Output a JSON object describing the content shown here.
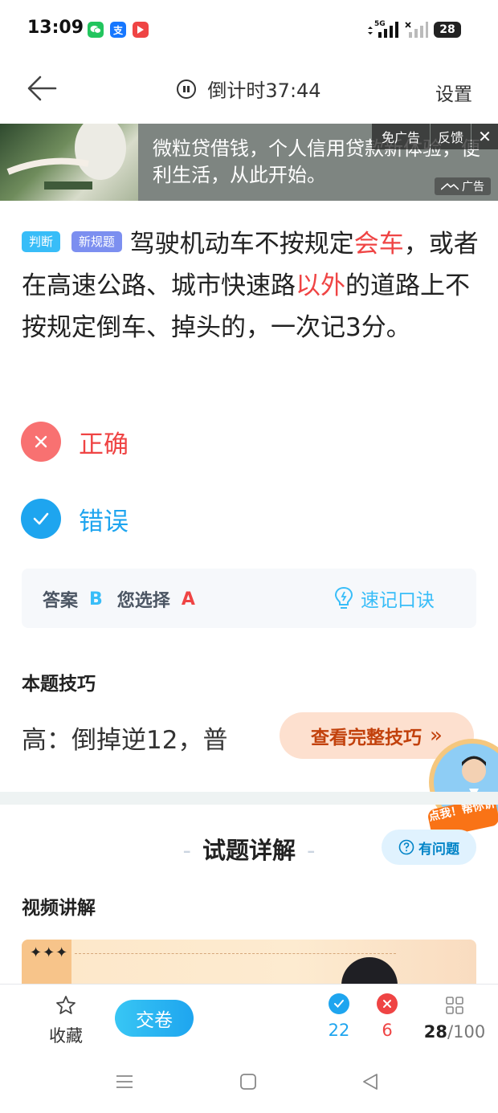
{
  "status_bar": {
    "time": "13:09",
    "apps": [
      {
        "icon": "wechat-icon",
        "color": "#22c55e",
        "glyph": "◉"
      },
      {
        "icon": "alipay-icon",
        "color": "#1677ff",
        "glyph": "支"
      },
      {
        "icon": "video-app-icon",
        "color": "#ef4444",
        "glyph": "▶"
      }
    ],
    "network_label": "5G",
    "battery": "28"
  },
  "header": {
    "countdown": "倒计时37:44",
    "settings_label": "设置"
  },
  "ad": {
    "text": "微粒贷借钱，个人信用贷款新体验，便利生活，从此开始。",
    "remove_ad_label": "免广告",
    "feedback_label": "反馈",
    "close_glyph": "✕",
    "ad_tag": "广告"
  },
  "question": {
    "tag_type": "判断",
    "tag_rule": "新规题",
    "segments": [
      {
        "text": "驾驶机动车不按规定",
        "highlight": false
      },
      {
        "text": "会车",
        "highlight": true
      },
      {
        "text": "，或者在高速公路、城市快速路",
        "highlight": false
      },
      {
        "text": "以外",
        "highlight": true
      },
      {
        "text": "的道路上不按规定倒车、掉头的，一次记3分。",
        "highlight": false
      }
    ]
  },
  "options": [
    {
      "label": "正确",
      "state": "wrong_choice",
      "color": "#f87171"
    },
    {
      "label": "错误",
      "state": "correct",
      "color": "#1ea5ef"
    }
  ],
  "answer": {
    "answer_label": "答案",
    "answer_value": "B",
    "choice_label": "您选择",
    "choice_value": "A",
    "mnemonic_label": "速记口诀"
  },
  "tips": {
    "title": "本题技巧",
    "preview": "高：倒掉逆12，普",
    "button_label": "查看完整技巧",
    "button_arrow": "»",
    "mascot_label": "点我！帮你讲"
  },
  "detail": {
    "title": "试题详解",
    "help_label": "有问题",
    "video_title": "视频讲解",
    "stars": "✦✦✦"
  },
  "bottom_bar": {
    "favorite_label": "收藏",
    "submit_label": "交卷",
    "correct_count": "22",
    "wrong_count": "6",
    "current": "28",
    "total": "/100"
  },
  "colors": {
    "accent": "#1ea5ef",
    "error": "#ef4444",
    "tip_bg": "#fde0cf"
  }
}
